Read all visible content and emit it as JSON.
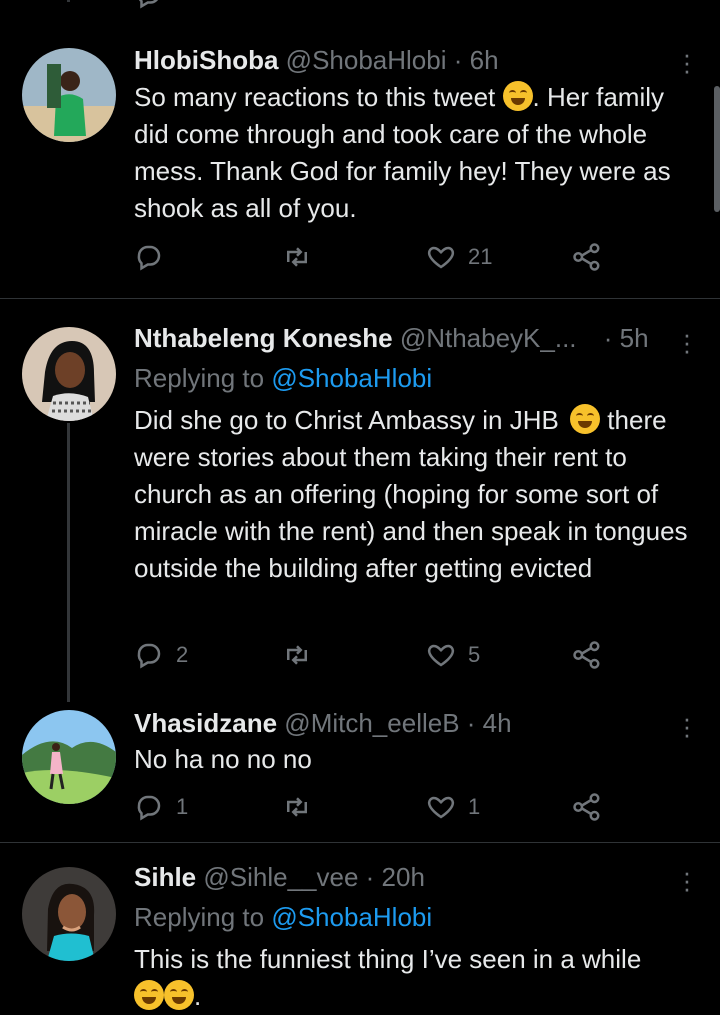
{
  "tweets": [
    {
      "name": "HlobiShoba",
      "handle": "@ShobaHlobi",
      "time": "· 6h",
      "reply_prefix": "",
      "reply_handle": "",
      "text_before": "So many reactions to this tweet",
      "emoji_1": "rolling-on-floor-laughing",
      "text_after": ". Her family did come through and took care of the whole mess. Thank God for family hey! They were as shook as all of you.",
      "replies": "",
      "retweets": "",
      "likes": "21"
    },
    {
      "name": "Nthabeleng Koneshe",
      "handle": "@NthabeyK_...",
      "time": "· 5h",
      "reply_prefix": "Replying to",
      "reply_handle": "@ShobaHlobi",
      "text_before": "Did she go to Christ Ambassy in JHB",
      "emoji_1": "grinning-face",
      "text_after": " there were stories about them taking their rent to church as an offering (hoping for some sort of miracle with the rent) and then speak in tongues outside the building after getting evicted",
      "replies": "2",
      "retweets": "",
      "likes": "5"
    },
    {
      "name": "Vhasidzane",
      "handle": "@Mitch_eelleB",
      "time": "· 4h",
      "reply_prefix": "",
      "reply_handle": "",
      "text_before": "No ha no no no",
      "text_after": "",
      "replies": "1",
      "retweets": "",
      "likes": "1"
    },
    {
      "name": "Sihle",
      "handle": "@Sihle__vee",
      "time": "· 20h",
      "reply_prefix": "Replying to",
      "reply_handle": "@ShobaHlobi",
      "text_before": "This is the funniest thing I’ve seen in a while",
      "emoji_1": "rolling-on-floor-laughing",
      "emoji_2": "rolling-on-floor-laughing",
      "text_after": "."
    }
  ],
  "icons": {
    "reply": "reply-icon",
    "retweet": "retweet-icon",
    "like": "heart-icon",
    "share": "share-icon",
    "more": "more-icon"
  },
  "colors": {
    "background": "#000000",
    "text": "#e7e9ea",
    "muted": "#71767b",
    "link": "#1d9bf0",
    "divider": "#2f3336"
  }
}
